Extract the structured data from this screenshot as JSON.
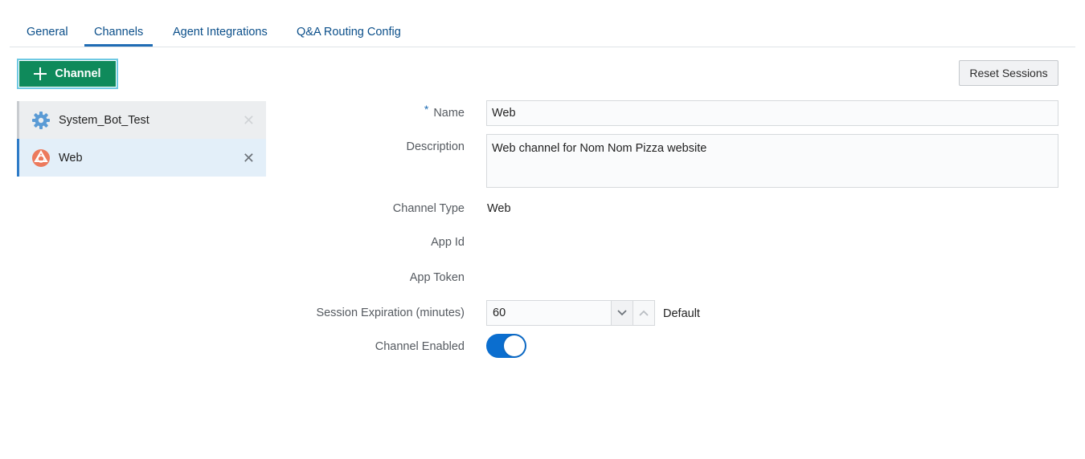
{
  "tabs": [
    {
      "label": "General",
      "active": false
    },
    {
      "label": "Channels",
      "active": true
    },
    {
      "label": "Agent Integrations",
      "active": false
    },
    {
      "label": "Q&A Routing Config",
      "active": false
    }
  ],
  "toolbar": {
    "add_channel_label": "Channel",
    "reset_sessions_label": "Reset Sessions"
  },
  "channels": [
    {
      "name": "System_Bot_Test",
      "icon": "gear-icon",
      "selected": false
    },
    {
      "name": "Web",
      "icon": "web-channel-icon",
      "selected": true
    }
  ],
  "form": {
    "name_label": "Name",
    "name_required_marker": "*",
    "name_value": "Web",
    "description_label": "Description",
    "description_value": "Web channel for Nom Nom Pizza website",
    "channel_type_label": "Channel Type",
    "channel_type_value": "Web",
    "app_id_label": "App Id",
    "app_token_label": "App Token",
    "session_expiration_label": "Session Expiration (minutes)",
    "session_expiration_value": "60",
    "session_expiration_default": "Default",
    "channel_enabled_label": "Channel Enabled",
    "channel_enabled": true
  },
  "colors": {
    "accent": "#0b6ecf",
    "add_button": "#0f8a5b",
    "tab_text": "#0b4f8a"
  }
}
